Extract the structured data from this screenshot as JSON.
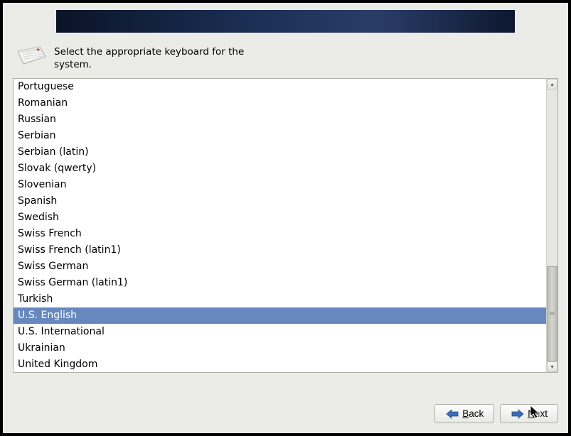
{
  "prompt": {
    "text": "Select the appropriate keyboard for the system."
  },
  "keyboard_list": {
    "items": [
      {
        "label": "Portuguese",
        "selected": false
      },
      {
        "label": "Romanian",
        "selected": false
      },
      {
        "label": "Russian",
        "selected": false
      },
      {
        "label": "Serbian",
        "selected": false
      },
      {
        "label": "Serbian (latin)",
        "selected": false
      },
      {
        "label": "Slovak (qwerty)",
        "selected": false
      },
      {
        "label": "Slovenian",
        "selected": false
      },
      {
        "label": "Spanish",
        "selected": false
      },
      {
        "label": "Swedish",
        "selected": false
      },
      {
        "label": "Swiss French",
        "selected": false
      },
      {
        "label": "Swiss French (latin1)",
        "selected": false
      },
      {
        "label": "Swiss German",
        "selected": false
      },
      {
        "label": "Swiss German (latin1)",
        "selected": false
      },
      {
        "label": "Turkish",
        "selected": false
      },
      {
        "label": "U.S. English",
        "selected": true
      },
      {
        "label": "U.S. International",
        "selected": false
      },
      {
        "label": "Ukrainian",
        "selected": false
      },
      {
        "label": "United Kingdom",
        "selected": false
      }
    ]
  },
  "buttons": {
    "back_prefix": "B",
    "back_suffix": "ack",
    "next_prefix": "N",
    "next_suffix": "ext"
  },
  "scrollbar": {
    "up_glyph": "▴",
    "down_glyph": "▾"
  }
}
